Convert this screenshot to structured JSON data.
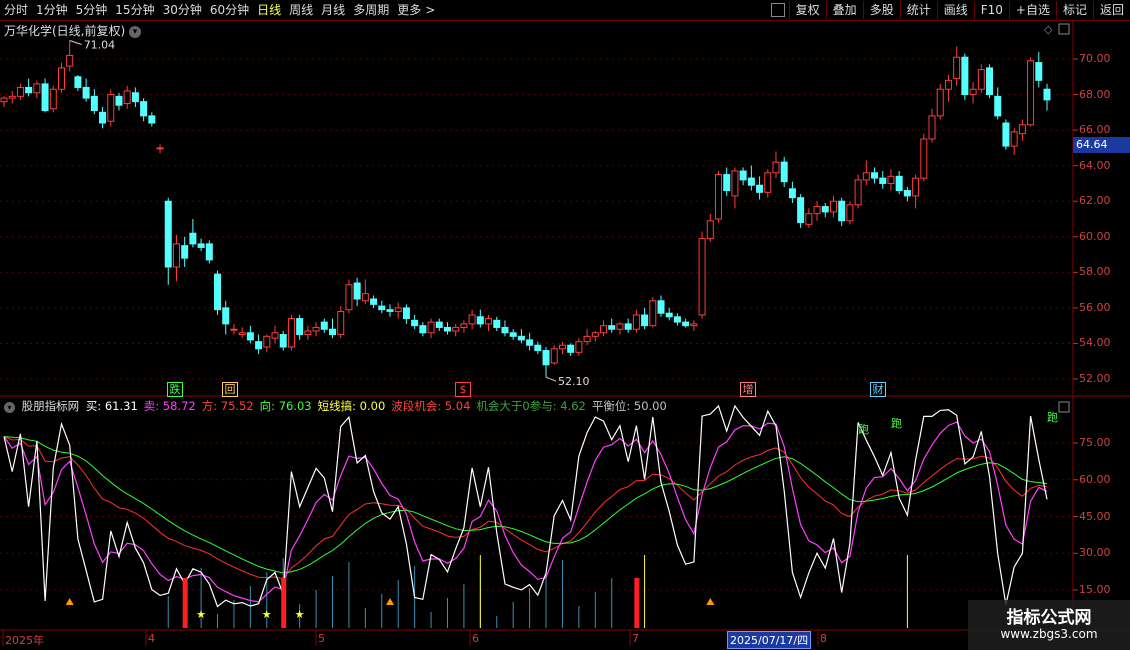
{
  "toolbar": {
    "left_items": [
      "分时",
      "1分钟",
      "5分钟",
      "15分钟",
      "30分钟",
      "60分钟",
      "日线",
      "周线",
      "月线",
      "多周期",
      "更多"
    ],
    "active_index": 6,
    "more_arrow": ">",
    "right_items": [
      "复权",
      "叠加",
      "多股",
      "统计",
      "画线",
      "F10",
      "+自选",
      "标记",
      "返回"
    ]
  },
  "chart": {
    "title": "万华化学(日线,前复权)",
    "high_label": "71.04",
    "low_label": "52.10",
    "current_price": "64.64",
    "price_axis": [
      "70.00",
      "68.00",
      "66.00",
      "64.00",
      "62.00",
      "60.00",
      "58.00",
      "56.00",
      "54.00",
      "52.00"
    ],
    "event_labels": [
      {
        "text": "跌",
        "color": "#40ff40"
      },
      {
        "text": "回",
        "color": "#ffcc66"
      },
      {
        "text": "$",
        "color": "#ff4040"
      },
      {
        "text": "增",
        "color": "#ff8080"
      },
      {
        "text": "财",
        "color": "#66ccff"
      }
    ]
  },
  "indicator": {
    "name": "股朋指标网",
    "fields": [
      {
        "label": "买: 61.31",
        "color": "#ffffff"
      },
      {
        "label": "卖: 58.72",
        "color": "#ff40ff"
      },
      {
        "label": "方: 75.52",
        "color": "#ff4040"
      },
      {
        "label": "向: 76.03",
        "color": "#40ff40"
      },
      {
        "label": "短线搞: 0.00",
        "color": "#ffff40"
      },
      {
        "label": "波段机会: 5.04",
        "color": "#ff4040"
      },
      {
        "label": "机会大于0参与: 4.62",
        "color": "#40a040"
      },
      {
        "label": "平衡位: 50.00",
        "color": "#c0c0c0"
      }
    ],
    "axis": [
      "75.00",
      "60.00",
      "45.00",
      "30.00",
      "15.00"
    ],
    "signal_text": "跑"
  },
  "dates": {
    "labels": [
      "2025年",
      "4",
      "5",
      "6",
      "7",
      "8"
    ],
    "selected": "2025/07/17/四"
  },
  "watermark": {
    "title": "指标公式网",
    "url": "www.zbgs3.com"
  },
  "candles": [
    [
      67.6,
      67.9,
      67.3,
      67.8
    ],
    [
      67.8,
      68.2,
      67.5,
      67.9
    ],
    [
      67.9,
      68.6,
      67.7,
      68.4
    ],
    [
      68.4,
      68.9,
      67.9,
      68.1
    ],
    [
      68.1,
      68.8,
      67.8,
      68.6
    ],
    [
      68.6,
      68.9,
      67.0,
      67.1
    ],
    [
      67.2,
      68.5,
      67.0,
      68.3
    ],
    [
      68.3,
      69.8,
      68.1,
      69.5
    ],
    [
      69.6,
      71.04,
      69.3,
      70.2
    ],
    [
      69.0,
      69.1,
      68.2,
      68.4
    ],
    [
      68.4,
      68.9,
      67.6,
      67.8
    ],
    [
      67.9,
      68.3,
      66.9,
      67.1
    ],
    [
      67.0,
      67.3,
      66.1,
      66.4
    ],
    [
      66.5,
      68.3,
      66.2,
      68.0
    ],
    [
      67.9,
      68.1,
      67.1,
      67.4
    ],
    [
      67.5,
      68.5,
      67.2,
      68.2
    ],
    [
      68.1,
      68.4,
      67.3,
      67.6
    ],
    [
      67.6,
      67.8,
      66.5,
      66.8
    ],
    [
      66.8,
      67.0,
      66.2,
      66.4
    ],
    [
      65.0,
      65.2,
      64.7,
      65.0
    ],
    [
      62.0,
      62.2,
      57.3,
      58.3
    ],
    [
      58.3,
      60.1,
      57.5,
      59.6
    ],
    [
      59.5,
      60.0,
      58.3,
      58.8
    ],
    [
      60.2,
      61.0,
      59.4,
      59.6
    ],
    [
      59.6,
      59.9,
      59.2,
      59.4
    ],
    [
      59.6,
      59.8,
      58.5,
      58.7
    ],
    [
      57.9,
      58.1,
      55.6,
      55.9
    ],
    [
      56.0,
      56.4,
      54.5,
      55.1
    ],
    [
      54.8,
      55.1,
      54.5,
      54.8
    ],
    [
      54.5,
      54.9,
      54.3,
      54.6
    ],
    [
      54.6,
      55.0,
      54.0,
      54.2
    ],
    [
      54.1,
      54.5,
      53.4,
      53.7
    ],
    [
      53.8,
      54.5,
      53.5,
      54.4
    ],
    [
      54.3,
      55.0,
      54.0,
      54.6
    ],
    [
      54.5,
      54.7,
      53.6,
      53.8
    ],
    [
      53.8,
      55.6,
      53.6,
      55.4
    ],
    [
      55.4,
      55.6,
      54.2,
      54.5
    ],
    [
      54.5,
      55.0,
      54.2,
      54.7
    ],
    [
      54.7,
      55.2,
      54.4,
      54.9
    ],
    [
      55.2,
      55.4,
      54.6,
      54.8
    ],
    [
      54.8,
      55.4,
      54.3,
      54.5
    ],
    [
      54.5,
      56.1,
      54.3,
      55.8
    ],
    [
      55.9,
      57.6,
      55.7,
      57.3
    ],
    [
      57.4,
      57.7,
      56.1,
      56.5
    ],
    [
      56.4,
      57.6,
      56.2,
      56.8
    ],
    [
      56.5,
      56.7,
      56.0,
      56.2
    ],
    [
      56.1,
      56.4,
      55.7,
      55.9
    ],
    [
      55.9,
      56.2,
      55.5,
      55.8
    ],
    [
      55.8,
      56.3,
      55.4,
      56.0
    ],
    [
      56.0,
      56.2,
      55.1,
      55.4
    ],
    [
      55.3,
      55.6,
      54.8,
      55.0
    ],
    [
      55.0,
      55.2,
      54.4,
      54.6
    ],
    [
      54.6,
      55.4,
      54.3,
      55.2
    ],
    [
      55.2,
      55.4,
      54.7,
      54.9
    ],
    [
      54.9,
      55.2,
      54.5,
      54.7
    ],
    [
      54.7,
      55.1,
      54.4,
      54.9
    ],
    [
      54.9,
      55.3,
      54.6,
      55.1
    ],
    [
      55.1,
      55.9,
      54.8,
      55.6
    ],
    [
      55.5,
      55.9,
      54.9,
      55.1
    ],
    [
      55.1,
      55.6,
      54.7,
      55.4
    ],
    [
      55.3,
      55.5,
      54.7,
      54.9
    ],
    [
      54.9,
      55.3,
      54.4,
      54.6
    ],
    [
      54.6,
      54.8,
      54.2,
      54.4
    ],
    [
      54.4,
      54.8,
      54.0,
      54.2
    ],
    [
      54.2,
      54.6,
      53.6,
      53.9
    ],
    [
      53.9,
      54.1,
      53.4,
      53.6
    ],
    [
      53.6,
      53.8,
      52.1,
      52.8
    ],
    [
      52.9,
      53.9,
      52.8,
      53.7
    ],
    [
      53.7,
      54.1,
      53.4,
      53.9
    ],
    [
      53.9,
      54.0,
      53.3,
      53.5
    ],
    [
      53.5,
      54.3,
      53.3,
      54.1
    ],
    [
      54.1,
      54.8,
      53.9,
      54.4
    ],
    [
      54.4,
      54.7,
      54.1,
      54.6
    ],
    [
      54.6,
      55.3,
      54.4,
      55.0
    ],
    [
      55.0,
      55.4,
      54.6,
      54.8
    ],
    [
      54.8,
      55.2,
      54.5,
      55.1
    ],
    [
      55.1,
      55.4,
      54.6,
      54.8
    ],
    [
      54.8,
      55.9,
      54.6,
      55.6
    ],
    [
      55.6,
      56.0,
      54.8,
      55.0
    ],
    [
      55.0,
      56.6,
      54.9,
      56.4
    ],
    [
      56.4,
      56.7,
      55.5,
      55.7
    ],
    [
      55.7,
      56.0,
      55.3,
      55.5
    ],
    [
      55.5,
      55.7,
      55.0,
      55.2
    ],
    [
      55.2,
      55.4,
      54.9,
      55.0
    ],
    [
      55.0,
      55.3,
      54.7,
      55.1
    ],
    [
      55.6,
      60.3,
      55.4,
      59.9
    ],
    [
      59.9,
      61.3,
      59.7,
      60.9
    ],
    [
      61.0,
      63.7,
      60.8,
      63.5
    ],
    [
      63.5,
      63.9,
      62.3,
      62.6
    ],
    [
      62.3,
      63.9,
      61.6,
      63.7
    ],
    [
      63.7,
      63.9,
      62.9,
      63.2
    ],
    [
      63.3,
      64.0,
      62.6,
      62.9
    ],
    [
      62.9,
      63.4,
      62.1,
      62.5
    ],
    [
      62.5,
      63.8,
      62.2,
      63.6
    ],
    [
      63.6,
      64.8,
      63.3,
      64.2
    ],
    [
      64.2,
      64.5,
      62.8,
      63.1
    ],
    [
      62.7,
      63.1,
      61.9,
      62.2
    ],
    [
      62.2,
      62.4,
      60.5,
      60.8
    ],
    [
      60.7,
      61.6,
      60.5,
      61.3
    ],
    [
      61.3,
      62.0,
      60.9,
      61.7
    ],
    [
      61.7,
      61.9,
      61.1,
      61.4
    ],
    [
      61.4,
      62.3,
      61.1,
      62.0
    ],
    [
      62.0,
      62.2,
      60.6,
      60.9
    ],
    [
      60.9,
      62.0,
      60.7,
      61.8
    ],
    [
      61.8,
      63.5,
      61.6,
      63.2
    ],
    [
      63.2,
      64.3,
      62.9,
      63.6
    ],
    [
      63.6,
      63.9,
      63.0,
      63.3
    ],
    [
      63.3,
      63.7,
      62.7,
      63.0
    ],
    [
      63.0,
      63.8,
      62.6,
      63.4
    ],
    [
      63.4,
      63.7,
      62.4,
      62.6
    ],
    [
      62.6,
      62.8,
      62.0,
      62.3
    ],
    [
      62.3,
      63.5,
      61.6,
      63.3
    ],
    [
      63.3,
      65.8,
      63.1,
      65.5
    ],
    [
      65.5,
      67.2,
      65.3,
      66.8
    ],
    [
      66.8,
      68.6,
      66.6,
      68.3
    ],
    [
      68.3,
      69.1,
      67.6,
      68.8
    ],
    [
      68.9,
      70.7,
      68.5,
      70.1
    ],
    [
      70.1,
      70.3,
      67.7,
      68.0
    ],
    [
      68.0,
      68.7,
      67.5,
      68.3
    ],
    [
      68.3,
      69.7,
      68.1,
      69.4
    ],
    [
      69.5,
      69.7,
      67.8,
      68.0
    ],
    [
      67.9,
      68.4,
      66.6,
      66.8
    ],
    [
      66.4,
      66.6,
      64.9,
      65.1
    ],
    [
      65.1,
      66.1,
      64.6,
      65.9
    ],
    [
      65.8,
      66.6,
      65.4,
      66.3
    ],
    [
      66.3,
      70.1,
      66.2,
      69.9
    ],
    [
      69.8,
      70.4,
      68.4,
      68.8
    ],
    [
      68.3,
      68.6,
      67.1,
      67.7
    ]
  ]
}
